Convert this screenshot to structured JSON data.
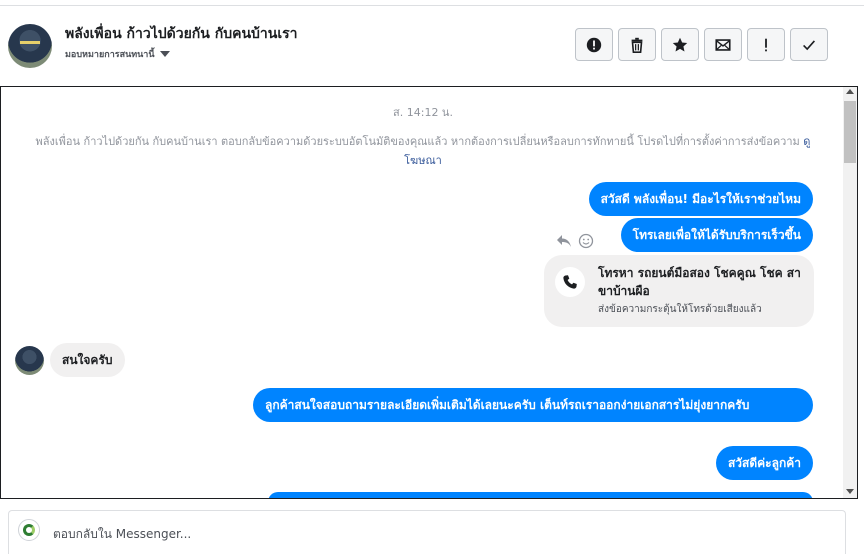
{
  "header": {
    "title": "พลังเพื่อน ก้าวไปด้วยกัน กับคนบ้านเรา",
    "assign_label": "มอบหมายการสนทนานี้",
    "actions": [
      {
        "icon": "alert-circle-icon",
        "label": "report"
      },
      {
        "icon": "trash-icon",
        "label": "delete"
      },
      {
        "icon": "star-icon",
        "label": "star"
      },
      {
        "icon": "envelope-icon",
        "label": "mark unread"
      },
      {
        "icon": "exclamation-icon",
        "label": "spam"
      },
      {
        "icon": "check-icon",
        "label": "done"
      }
    ]
  },
  "conversation": {
    "timestamp": "ส. 14:12 น.",
    "notice_text": "พลังเพื่อน ก้าวไปด้วยกัน กับคนบ้านเรา ตอบกลับข้อความด้วยระบบอัตโนมัติของคุณแล้ว หากต้องการเปลี่ยนหรือลบการทักทายนี้ โปรดไปที่การตั้งค่าการส่งข้อความ",
    "notice_link": "ดูโฆษณา",
    "messages": [
      {
        "direction": "out",
        "text": "สวัสดี พลังเพื่อน! มีอะไรให้เราช่วยไหม"
      },
      {
        "direction": "out",
        "text": "โทรเลยเพื่อให้ได้รับบริการเร็วขึ้น"
      },
      {
        "direction": "in",
        "text": "สนใจครับ"
      },
      {
        "direction": "out",
        "text": "ลูกค้าสนใจสอบถามรายละเอียดเพิ่มเติมได้เลยนะครับ เต็นท์รถเราออกง่ายเอกสารไม่ยุ่งยากครับ"
      },
      {
        "direction": "out",
        "text": "สวัสดีค่ะลูกค้า"
      }
    ],
    "call_card": {
      "title": "โทรหา รถยนต์มือสอง โชคคูณ โชค สาขาบ้านผือ",
      "subtitle": "ส่งข้อความกระตุ้นให้โทรด้วยเสียงแล้ว"
    },
    "message_tools": [
      "reply-icon",
      "emoji-icon"
    ]
  },
  "composer": {
    "placeholder": "ตอบกลับใน Messenger..."
  },
  "colors": {
    "outgoing_bubble": "#0084ff",
    "incoming_bubble": "#f1f0f0",
    "link": "#365899"
  }
}
